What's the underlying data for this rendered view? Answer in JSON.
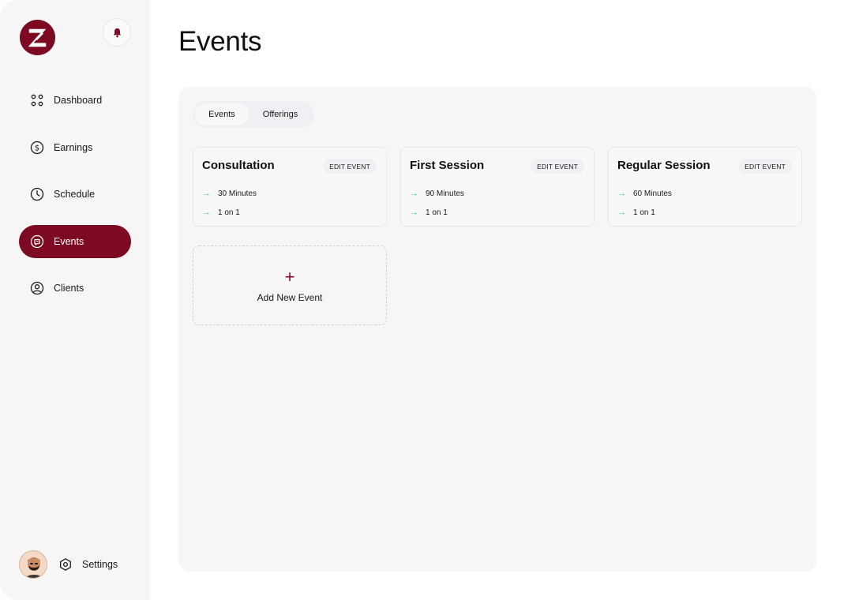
{
  "colors": {
    "brand": "#7d0a22",
    "accent": "#35c6b7",
    "sidebar_bg": "#f6f6f6",
    "panel_bg": "#f6f6f7"
  },
  "header": {
    "logo_icon": "z-logo-icon",
    "bell_icon": "bell-icon"
  },
  "sidebar": {
    "items": [
      {
        "label": "Dashboard",
        "icon": "grid-dots-icon"
      },
      {
        "label": "Earnings",
        "icon": "dollar-circle-icon"
      },
      {
        "label": "Schedule",
        "icon": "clock-icon"
      },
      {
        "label": "Events",
        "icon": "events-icon",
        "active": true
      },
      {
        "label": "Clients",
        "icon": "user-circle-icon"
      }
    ],
    "settings_label": "Settings",
    "settings_icon": "hexagon-gear-icon"
  },
  "main": {
    "title": "Events",
    "tabs": [
      {
        "label": "Events",
        "active": true
      },
      {
        "label": "Offerings",
        "active": false
      }
    ],
    "events": [
      {
        "name": "Consultation",
        "edit_label": "EDIT EVENT",
        "duration": "30 Minutes",
        "type": "1 on 1"
      },
      {
        "name": "First Session",
        "edit_label": "EDIT EVENT",
        "duration": "90 Minutes",
        "type": "1 on 1"
      },
      {
        "name": "Regular Session",
        "edit_label": "EDIT EVENT",
        "duration": "60 Minutes",
        "type": "1 on 1"
      }
    ],
    "add_new": {
      "icon_glyph": "+",
      "label": "Add New Event"
    }
  }
}
